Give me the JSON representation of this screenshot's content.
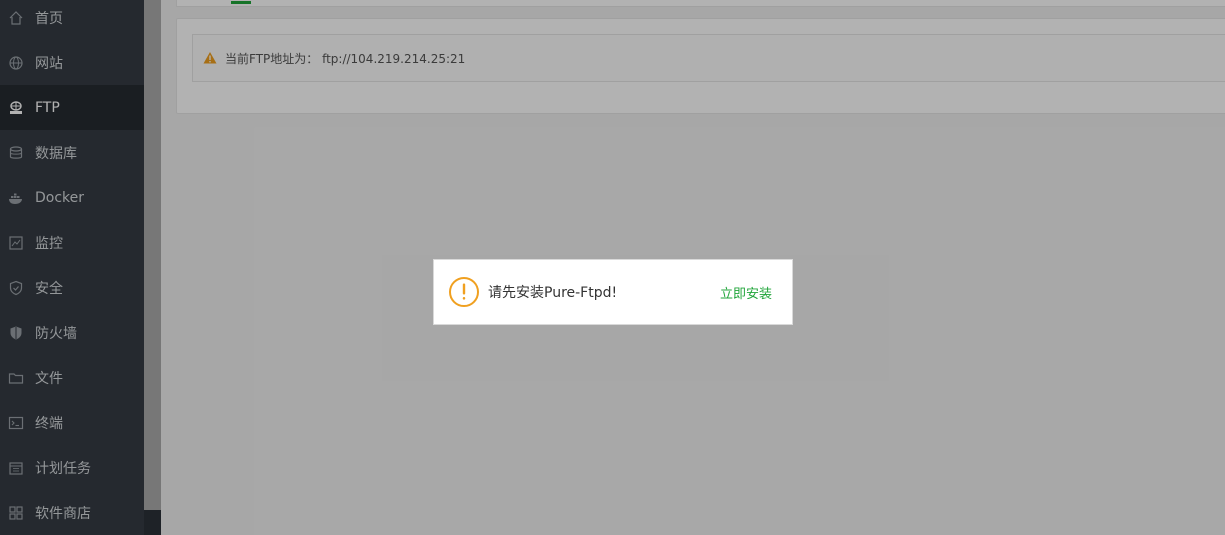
{
  "sidebar": {
    "items": [
      {
        "label": "首页",
        "icon": "home-icon"
      },
      {
        "label": "网站",
        "icon": "globe-icon"
      },
      {
        "label": "FTP",
        "icon": "ftp-icon",
        "active": true
      },
      {
        "label": "数据库",
        "icon": "database-icon"
      },
      {
        "label": "Docker",
        "icon": "docker-icon"
      },
      {
        "label": "监控",
        "icon": "monitor-icon"
      },
      {
        "label": "安全",
        "icon": "shield-icon"
      },
      {
        "label": "防火墙",
        "icon": "firewall-icon"
      },
      {
        "label": "文件",
        "icon": "folder-icon"
      },
      {
        "label": "终端",
        "icon": "terminal-icon"
      },
      {
        "label": "计划任务",
        "icon": "calendar-icon"
      },
      {
        "label": "软件商店",
        "icon": "apps-icon"
      }
    ]
  },
  "main": {
    "notice_text": "当前FTP地址为： ftp://104.219.214.25:21"
  },
  "dialog": {
    "message": "请先安装Pure-Ftpd!",
    "action_label": "立即安装"
  },
  "colors": {
    "accent": "#20a53a",
    "warning": "#f0a020",
    "sidebar_bg": "#353c44"
  }
}
